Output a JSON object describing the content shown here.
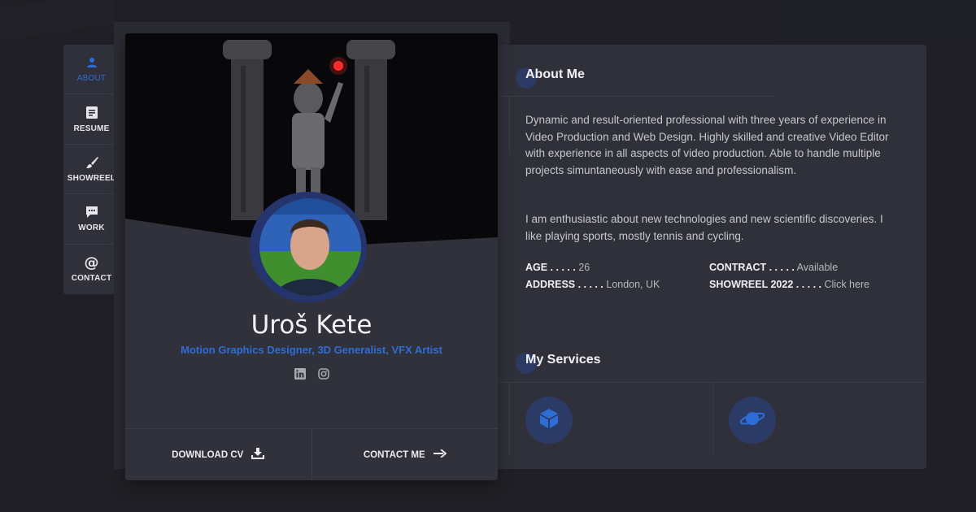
{
  "nav": {
    "items": [
      {
        "label": "ABOUT",
        "icon": "user-icon",
        "active": true
      },
      {
        "label": "RESUME",
        "icon": "resume-icon",
        "active": false
      },
      {
        "label": "SHOWREEL",
        "icon": "brush-icon",
        "active": false
      },
      {
        "label": "WORK",
        "icon": "chat-icon",
        "active": false
      },
      {
        "label": "CONTACT",
        "icon": "at-icon",
        "active": false
      }
    ]
  },
  "profile": {
    "name": "Uroš Kete",
    "subtitle": "Motion Graphics Designer, 3D Generalist, VFX Artist",
    "socials": [
      "linkedin-icon",
      "instagram-icon"
    ],
    "download_label": "DOWNLOAD CV",
    "contact_label": "CONTACT ME"
  },
  "about": {
    "title": "About Me",
    "paragraph1": "Dynamic and result-oriented professional with three years of experience in Video Production and Web Design. Highly skilled and creative Video Editor with experience in all aspects of video production. Able to handle multiple projects simuntaneously with ease and professionalism.",
    "paragraph2": "I am enthusiastic about new technologies and new scientific discoveries. I like playing sports, mostly tennis and cycling.",
    "info": {
      "age_label": "AGE . . . . .",
      "age_value": "26",
      "address_label": "ADDRESS . . . . .",
      "address_value": "London, UK",
      "contract_label": "CONTRACT . . . . .",
      "contract_value": "Available",
      "showreel_label": "SHOWREEL 2022 . . . . .",
      "showreel_value": "Click here"
    }
  },
  "services": {
    "title": "My Services",
    "icons": [
      "cube-icon",
      "planet-icon"
    ]
  },
  "colors": {
    "accent": "#2f6dd6",
    "background": "#1f1f25",
    "panel": "#30303a"
  }
}
